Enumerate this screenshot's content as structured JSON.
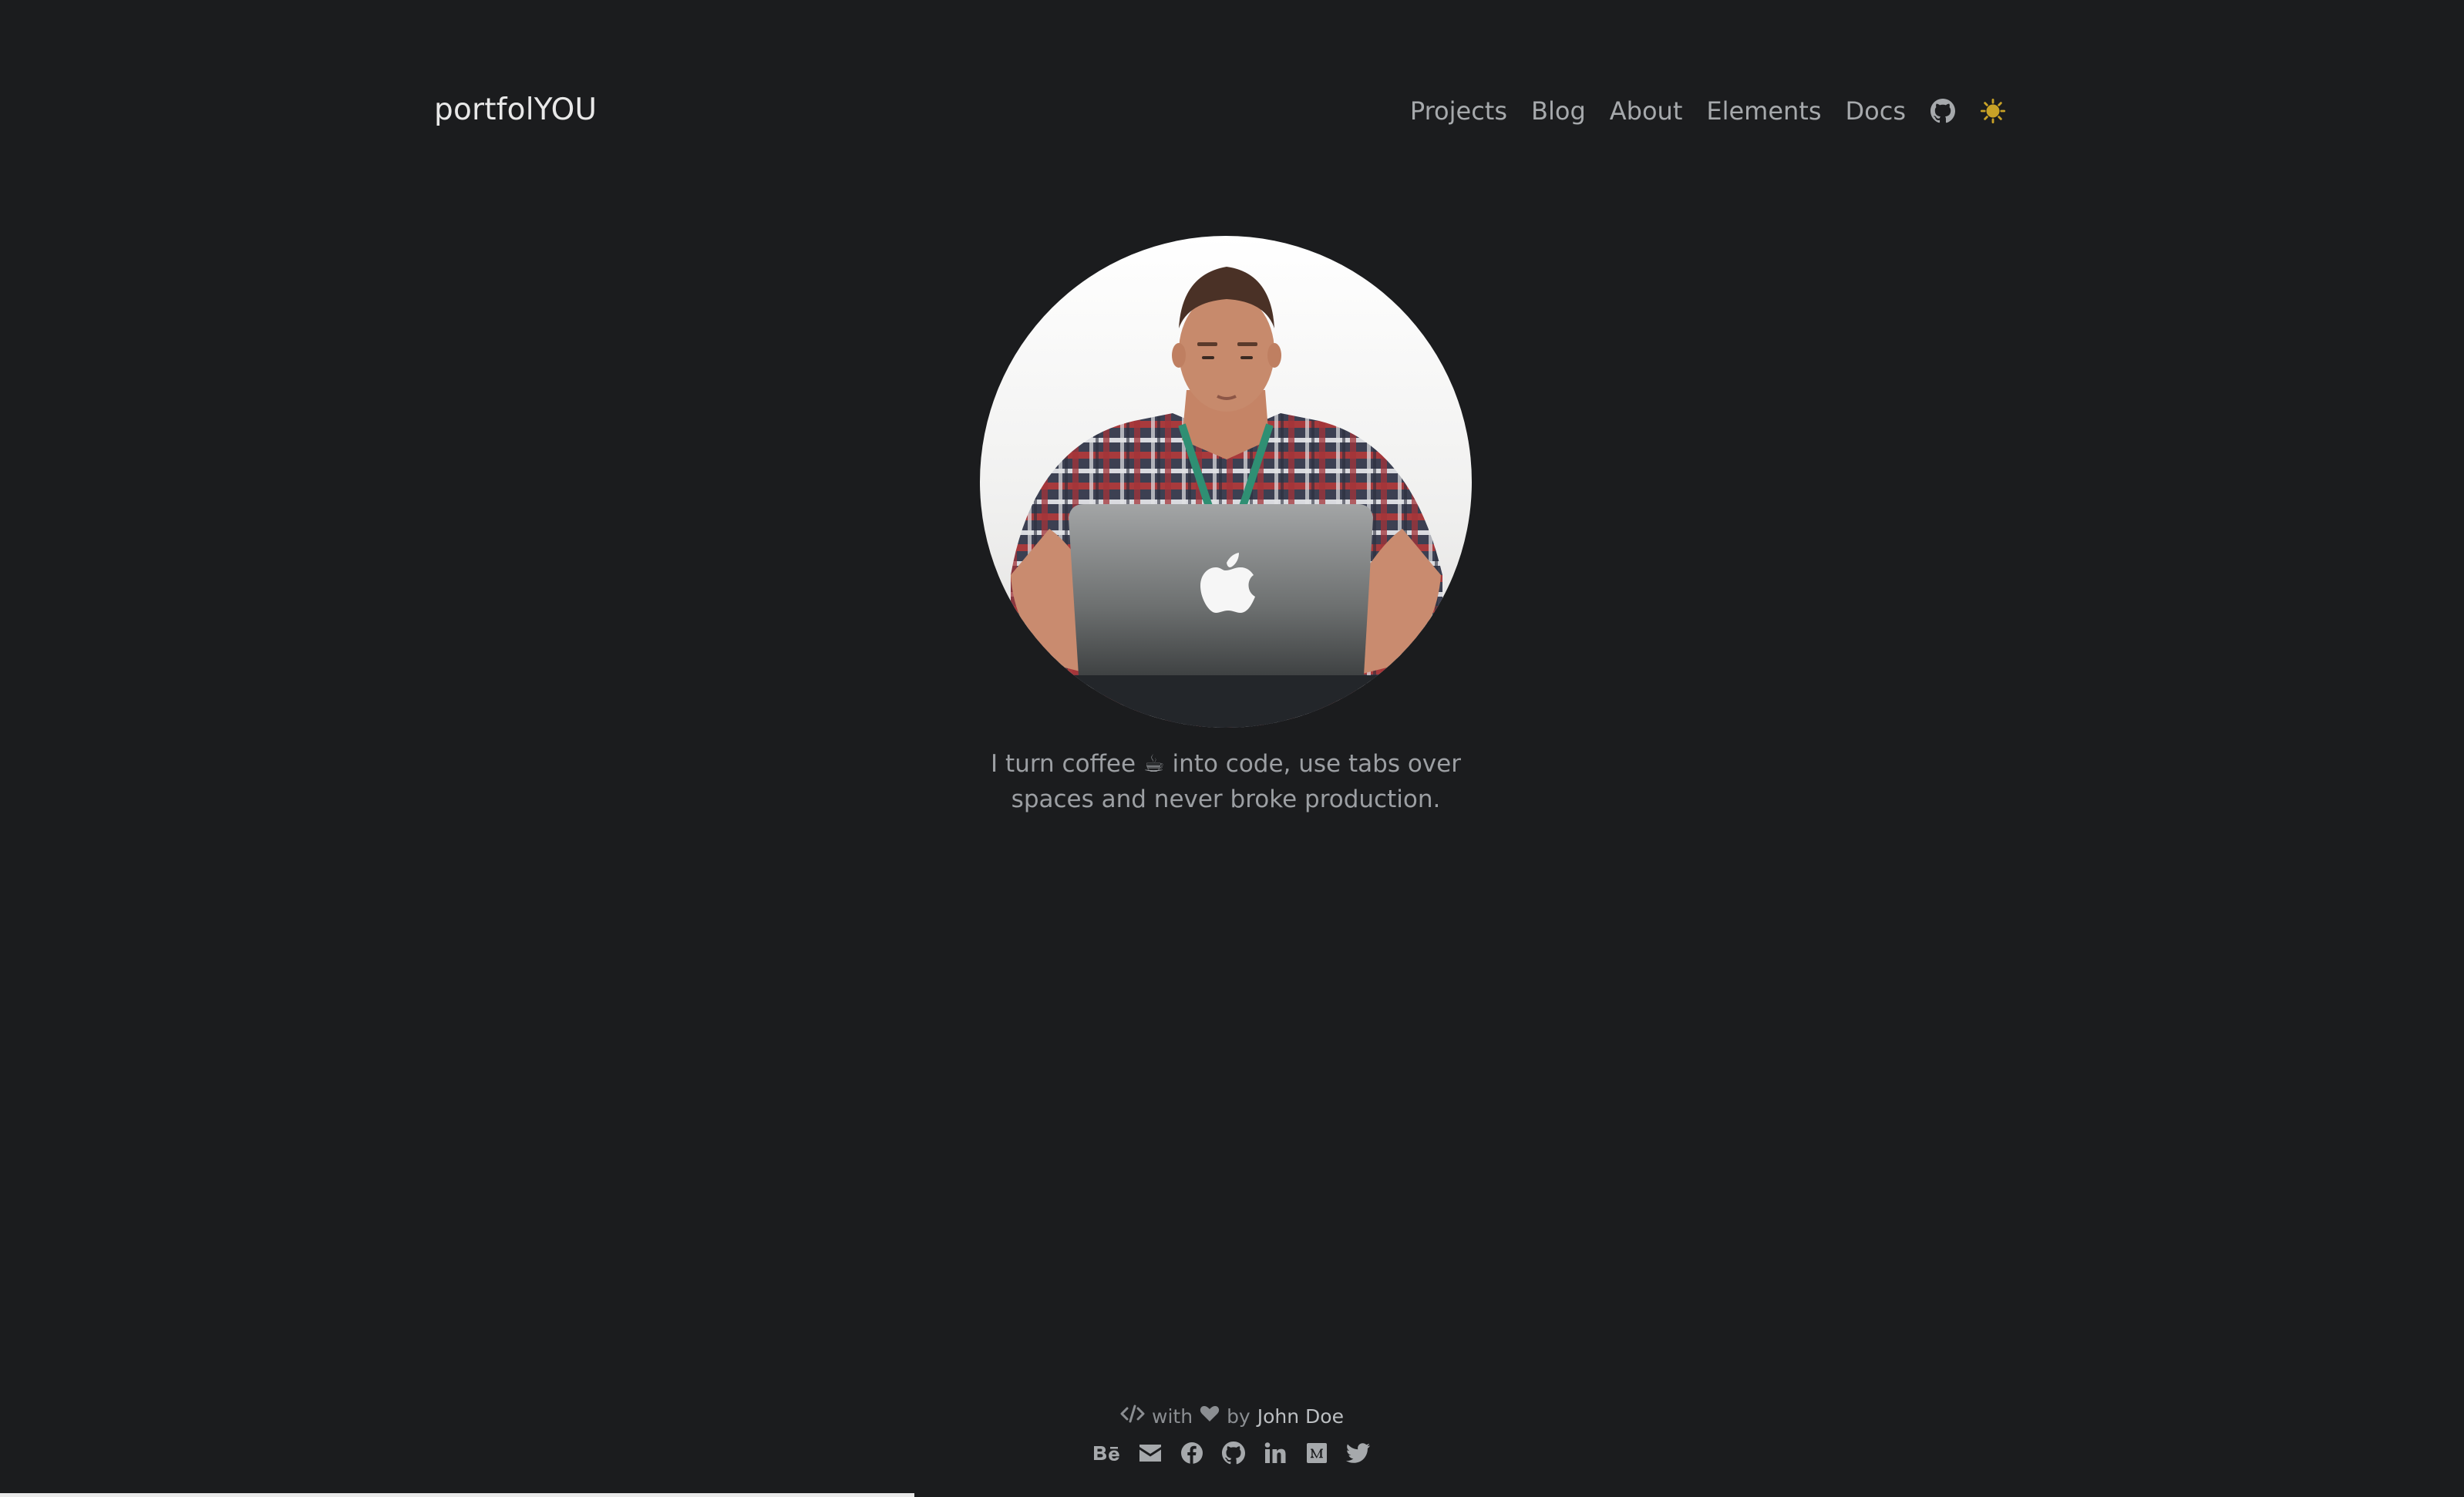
{
  "header": {
    "brand": "portfolYOU",
    "nav": [
      {
        "label": "Projects"
      },
      {
        "label": "Blog"
      },
      {
        "label": "About"
      },
      {
        "label": "Elements"
      },
      {
        "label": "Docs"
      }
    ],
    "icons": [
      "github-icon",
      "sun-icon"
    ]
  },
  "hero": {
    "bio_line1": "I turn coffee ☕ into code, use tabs over",
    "bio_line2": "spaces and never broke production."
  },
  "footer": {
    "with_text": "with",
    "by_text": "by",
    "author": "John Doe",
    "social_icons": [
      "behance-icon",
      "email-icon",
      "facebook-icon",
      "github-icon",
      "linkedin-icon",
      "medium-icon",
      "twitter-icon"
    ]
  },
  "colors": {
    "background": "#1b1c1e",
    "nav_text": "#a6a9ac",
    "sun_accent": "#c9a227"
  }
}
